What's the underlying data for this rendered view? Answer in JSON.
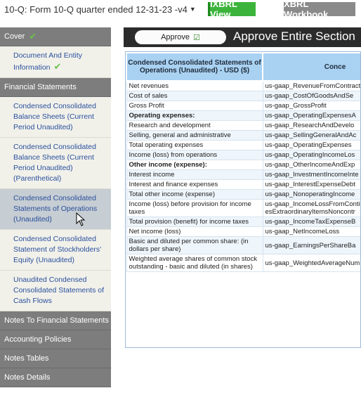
{
  "top": {
    "doc_title": "10-Q: Form 10-Q quarter ended 12-31-23 -v4",
    "ixbrl_label": "iXBRL View",
    "xbrl_label": "XBRL Workbook"
  },
  "sidebar": {
    "sections": [
      {
        "label": "Cover"
      },
      {
        "label": "Financial Statements"
      },
      {
        "label": "Notes To Financial Statements"
      },
      {
        "label": "Accounting Policies"
      },
      {
        "label": "Notes Tables"
      },
      {
        "label": "Notes Details"
      }
    ],
    "cover_items": [
      "Document And Entity Information"
    ],
    "financial_items": [
      "Condensed Consolidated Balance Sheets (Current Period Unaudited)",
      "Condensed Consolidated Balance Sheets (Current Period Unaudited) (Parenthetical)",
      "Condensed Consolidated Statements of Operations (Unaudited)",
      "Condensed Consolidated Statement of Stockholders' Equity (Unaudited)",
      "Unaudited Condensed Consolidated Statements of Cash Flows"
    ]
  },
  "main": {
    "approve_label": "Approve",
    "section_title": "Approve Entire Section",
    "table": {
      "headers": [
        "Condensed Consolidated Statements of Operations (Unaudited) - USD ($)",
        "Conce"
      ],
      "rows": [
        [
          "Net revenues",
          "us-gaap_RevenueFromContractW... Tax"
        ],
        [
          "Cost of sales",
          "us-gaap_CostOfGoodsAndSe"
        ],
        [
          "Gross Profit",
          "us-gaap_GrossProfit"
        ],
        [
          "Operating expenses:",
          "us-gaap_OperatingExpensesA"
        ],
        [
          "Research and development",
          "us-gaap_ResearchAndDevelo"
        ],
        [
          "Selling, general and administrative",
          "us-gaap_SellingGeneralAndAc"
        ],
        [
          "Total operating expenses",
          "us-gaap_OperatingExpenses"
        ],
        [
          "Income (loss) from operations",
          "us-gaap_OperatingIncomeLos"
        ],
        [
          "Other income (expense):",
          "us-gaap_OtherIncomeAndExp"
        ],
        [
          "Interest income",
          "us-gaap_InvestmentIncomeInte"
        ],
        [
          "Interest and finance expenses",
          "us-gaap_InterestExpenseDebt"
        ],
        [
          "Total other income (expense)",
          "us-gaap_NonoperatingIncome"
        ],
        [
          "Income (loss) before provision for income taxes",
          "us-gaap_IncomeLossFromContinu esExtraordinaryItemsNoncontr"
        ],
        [
          "Total provision (benefit) for income taxes",
          "us-gaap_IncomeTaxExpenseB"
        ],
        [
          "Net income (loss)",
          "us-gaap_NetIncomeLoss"
        ],
        [
          "Basic and diluted per common share: (in dollars per share)",
          "us-gaap_EarningsPerShareBa"
        ],
        [
          "Weighted average shares of common stock outstanding - basic and diluted (in shares)",
          "us-gaap_WeightedAverageNumbe"
        ]
      ],
      "bold_rows": [
        3,
        8
      ]
    }
  }
}
